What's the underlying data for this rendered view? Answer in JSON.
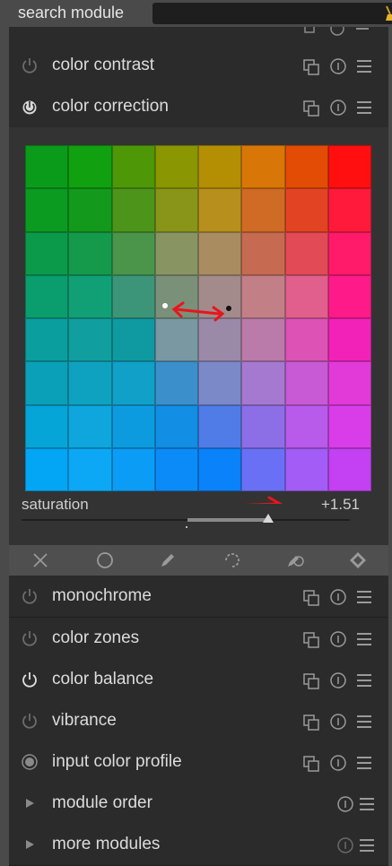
{
  "search": {
    "label": "search module",
    "placeholder": ""
  },
  "modules_above": [
    {
      "name": "color contrast",
      "power": "off"
    },
    {
      "name": "color correction",
      "power": "on",
      "expanded": true
    }
  ],
  "color_correction": {
    "saturation_label": "saturation",
    "saturation_value": "+1.51",
    "saturation_fraction": 0.75,
    "grid_colors": [
      [
        "#0a9b1a",
        "#11a00f",
        "#4e9707",
        "#8a9702",
        "#b48f03",
        "#d87707",
        "#e24c05",
        "#ff0f0f"
      ],
      [
        "#0a9b20",
        "#139a1c",
        "#4d951a",
        "#889518",
        "#b78f1c",
        "#cf6b24",
        "#e24423",
        "#ff1a3b"
      ],
      [
        "#0a9a4a",
        "#159a4c",
        "#4a954a",
        "#889563",
        "#a98c60",
        "#c66a52",
        "#e24a55",
        "#ff1a6a"
      ],
      [
        "#0a9d6e",
        "#11a075",
        "#3d9579",
        "#7b9079",
        "#a28b8a",
        "#c27f86",
        "#e05f8c",
        "#ff1a8a"
      ],
      [
        "#0a9e9e",
        "#119e9e",
        "#0e9aa0",
        "#7a98a2",
        "#9b89a8",
        "#ba7aaa",
        "#dc52b5",
        "#f222b8"
      ],
      [
        "#0aa0b8",
        "#0fa2c0",
        "#10a0c8",
        "#3b8fcb",
        "#7c89c8",
        "#a579cf",
        "#c85ad5",
        "#e23ad8"
      ],
      [
        "#06a5d8",
        "#0ea6dc",
        "#0d9be0",
        "#128ee4",
        "#4f7ce6",
        "#8c6fe6",
        "#b85aea",
        "#d93de8"
      ],
      [
        "#02a6f4",
        "#0ca8f5",
        "#0b9cf6",
        "#0b8bf8",
        "#0a82fa",
        "#6a70f6",
        "#a35cf5",
        "#c440f3"
      ]
    ]
  },
  "modules_below": [
    {
      "name": "monochrome",
      "power": "off"
    },
    {
      "name": "color zones",
      "power": "off"
    },
    {
      "name": "color balance",
      "power": "on"
    },
    {
      "name": "vibrance",
      "power": "off"
    },
    {
      "name": "input color profile",
      "power": "always"
    },
    {
      "name": "module order",
      "power": "group"
    },
    {
      "name": "more modules",
      "power": "group"
    }
  ],
  "toolbar_icons": [
    "off-icon",
    "uniform-icon",
    "drawn-mask-icon",
    "parametric-mask-icon",
    "drawn-parametric-mask-icon",
    "raster-mask-icon"
  ]
}
